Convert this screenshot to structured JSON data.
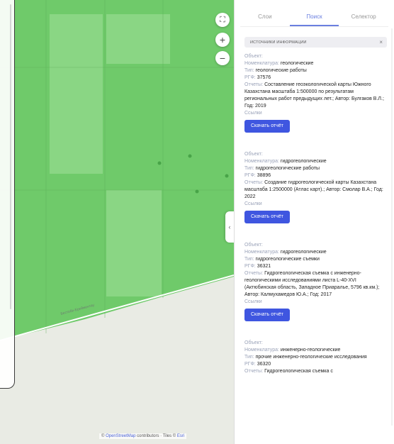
{
  "map": {
    "colors": {
      "land": "#e9ebe4",
      "zone_main": "#6fca6a",
      "zone_light": "#93d98e",
      "road": "#ffffff",
      "river_label": "#6d7f71"
    },
    "controls": {
      "layers_icon": "layers-icon",
      "zoom_in": "+",
      "zoom_out": "−"
    },
    "road_label": "Бестобе-Ерейментау",
    "attribution": {
      "prefix": "©",
      "osm": "OpenStreetMap",
      "contributors": " contributors · Tiles ©",
      "esri": " Esri"
    },
    "collapse_handle": "‹"
  },
  "panel": {
    "tabs": [
      {
        "label": "Слои",
        "active": false
      },
      {
        "label": "Поиск",
        "active": true
      },
      {
        "label": "Селектор",
        "active": false
      }
    ],
    "filter": {
      "text": "ИСТОЧНИКИ ИНФОРМАЦИИ",
      "clear": "×"
    },
    "labels": {
      "object": "Объект:",
      "nomenclature": "Номенклатура:",
      "type": "Тип:",
      "rfg": "РГФ:",
      "reports": "Отчеты:",
      "links": "Ссылки"
    },
    "results": [
      {
        "nomenclature": "геологические",
        "type": "геологические работы",
        "rfg": "37576",
        "report": "Составление геоэкологической карты Южного Казахстана масштаба 1:500000 по результатам региональных работ предыдущих лет.; Автор: Булгаков В.Л.; Год: 2019",
        "button": "Скачать отчёт"
      },
      {
        "nomenclature": "гидрогеологические",
        "type": "гидрогеологические работы",
        "rfg": "38896",
        "report": "Создание гидрогеологической карты Казахстана масштаба 1:2500000 (Атлас карт).; Автор: Смолар В.А.; Год: 2022",
        "button": "Скачать отчёт"
      },
      {
        "nomenclature": "гидрогеологические",
        "type": "гидрогеологические съемки",
        "rfg": "36321",
        "report": "Гидрогеологическая съемка с инженерно-геологическими исследованиями листа L-40-XVI (Актюбинская область, Западное Приаралье, 5796 кв.км.); Автор: Калмухамедов Ю.А.; Год: 2017",
        "button": "Скачать отчёт"
      },
      {
        "nomenclature": "инженерно-геологические",
        "type": "прочие инженерно-геологические исследования",
        "rfg": "36320",
        "report": "Гидрогеологическая съемка с",
        "button": ""
      }
    ]
  }
}
